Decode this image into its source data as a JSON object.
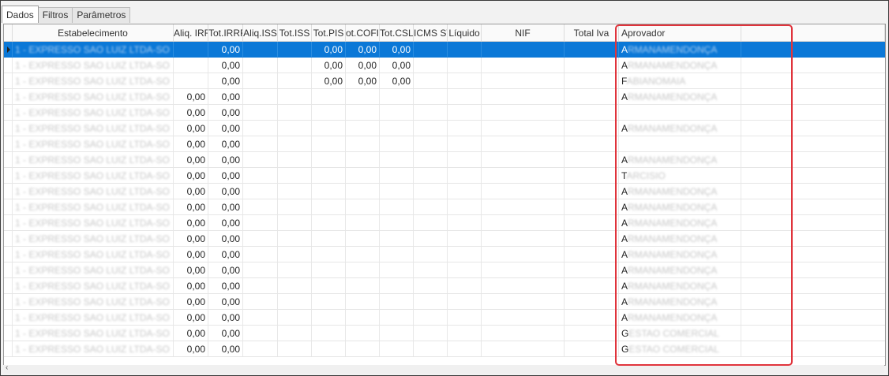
{
  "tabs": [
    {
      "label": "Dados",
      "active": true
    },
    {
      "label": "Filtros",
      "active": false
    },
    {
      "label": "Parâmetros",
      "active": false
    }
  ],
  "columns": [
    {
      "key": "ind",
      "label": "",
      "width": 11
    },
    {
      "key": "est",
      "label": "Estabelecimento",
      "width": 204
    },
    {
      "key": "aliq_irr",
      "label": "Aliq. IRR",
      "width": 44
    },
    {
      "key": "tot_irrf",
      "label": "Tot.IRRF",
      "width": 44
    },
    {
      "key": "aliq_iss",
      "label": "Aliq.ISS",
      "width": 44
    },
    {
      "key": "tot_iss",
      "label": "Tot.ISS",
      "width": 43
    },
    {
      "key": "tot_pis",
      "label": "Tot.PIS",
      "width": 43
    },
    {
      "key": "tot_cofins",
      "label": "ot.COFIN",
      "width": 43
    },
    {
      "key": "tot_csll",
      "label": "Tot.CSLL",
      "width": 43
    },
    {
      "key": "icms_st",
      "label": "ICMS ST",
      "width": 43
    },
    {
      "key": "liquido",
      "label": "Líquido",
      "width": 43
    },
    {
      "key": "nif",
      "label": "NIF",
      "width": 105
    },
    {
      "key": "total_iva",
      "label": "Total Iva",
      "width": 69
    },
    {
      "key": "aprovador",
      "label": "Aprovador",
      "width": 155
    },
    {
      "key": "extra",
      "label": "",
      "width": 182
    }
  ],
  "rows": [
    {
      "est": "1 - EXPRESSO SAO LUIZ LTDA-SO",
      "aliq_irr": "",
      "tot_irrf": "0,00",
      "tot_pis": "0,00",
      "tot_cofins": "0,00",
      "tot_csll": "0,00",
      "aprovador_initial": "A",
      "aprovador_rest": "RMANAMENDONÇA",
      "selected": true
    },
    {
      "est": "1 - EXPRESSO SAO LUIZ LTDA-SO",
      "aliq_irr": "",
      "tot_irrf": "0,00",
      "tot_pis": "0,00",
      "tot_cofins": "0,00",
      "tot_csll": "0,00",
      "aprovador_initial": "A",
      "aprovador_rest": "RMANAMENDONÇA"
    },
    {
      "est": "1 - EXPRESSO SAO LUIZ LTDA-SO",
      "aliq_irr": "",
      "tot_irrf": "0,00",
      "tot_pis": "0,00",
      "tot_cofins": "0,00",
      "tot_csll": "0,00",
      "aprovador_initial": "F",
      "aprovador_rest": "ABIANOMAIA"
    },
    {
      "est": "1 - EXPRESSO SAO LUIZ LTDA-SO",
      "aliq_irr": "0,00",
      "tot_irrf": "0,00",
      "aprovador_initial": "A",
      "aprovador_rest": "RMANAMENDONÇA"
    },
    {
      "est": "1 - EXPRESSO SAO LUIZ LTDA-SO",
      "aliq_irr": "0,00",
      "tot_irrf": "0,00",
      "aprovador_initial": "",
      "aprovador_rest": ""
    },
    {
      "est": "1 - EXPRESSO SAO LUIZ LTDA-SO",
      "aliq_irr": "0,00",
      "tot_irrf": "0,00",
      "aprovador_initial": "A",
      "aprovador_rest": "RMANAMENDONÇA"
    },
    {
      "est": "1 - EXPRESSO SAO LUIZ LTDA-SO",
      "aliq_irr": "0,00",
      "tot_irrf": "0,00",
      "aprovador_initial": "",
      "aprovador_rest": ""
    },
    {
      "est": "1 - EXPRESSO SAO LUIZ LTDA-SO",
      "aliq_irr": "0,00",
      "tot_irrf": "0,00",
      "aprovador_initial": "A",
      "aprovador_rest": "RMANAMENDONÇA"
    },
    {
      "est": "1 - EXPRESSO SAO LUIZ LTDA-SO",
      "aliq_irr": "0,00",
      "tot_irrf": "0,00",
      "aprovador_initial": "T",
      "aprovador_rest": "ARCISIO"
    },
    {
      "est": "1 - EXPRESSO SAO LUIZ LTDA-SO",
      "aliq_irr": "0,00",
      "tot_irrf": "0,00",
      "aprovador_initial": "A",
      "aprovador_rest": "RMANAMENDONÇA"
    },
    {
      "est": "1 - EXPRESSO SAO LUIZ LTDA-SO",
      "aliq_irr": "0,00",
      "tot_irrf": "0,00",
      "aprovador_initial": "A",
      "aprovador_rest": "RMANAMENDONÇA"
    },
    {
      "est": "1 - EXPRESSO SAO LUIZ LTDA-SO",
      "aliq_irr": "0,00",
      "tot_irrf": "0,00",
      "aprovador_initial": "A",
      "aprovador_rest": "RMANAMENDONÇA"
    },
    {
      "est": "1 - EXPRESSO SAO LUIZ LTDA-SO",
      "aliq_irr": "0,00",
      "tot_irrf": "0,00",
      "aprovador_initial": "A",
      "aprovador_rest": "RMANAMENDONÇA"
    },
    {
      "est": "1 - EXPRESSO SAO LUIZ LTDA-SO",
      "aliq_irr": "0,00",
      "tot_irrf": "0,00",
      "aprovador_initial": "A",
      "aprovador_rest": "RMANAMENDONÇA"
    },
    {
      "est": "1 - EXPRESSO SAO LUIZ LTDA-SO",
      "aliq_irr": "0,00",
      "tot_irrf": "0,00",
      "aprovador_initial": "A",
      "aprovador_rest": "RMANAMENDONÇA"
    },
    {
      "est": "1 - EXPRESSO SAO LUIZ LTDA-SO",
      "aliq_irr": "0,00",
      "tot_irrf": "0,00",
      "aprovador_initial": "A",
      "aprovador_rest": "RMANAMENDONÇA"
    },
    {
      "est": "1 - EXPRESSO SAO LUIZ LTDA-SO",
      "aliq_irr": "0,00",
      "tot_irrf": "0,00",
      "aprovador_initial": "A",
      "aprovador_rest": "RMANAMENDONÇA"
    },
    {
      "est": "1 - EXPRESSO SAO LUIZ LTDA-SO",
      "aliq_irr": "0,00",
      "tot_irrf": "0,00",
      "aprovador_initial": "A",
      "aprovador_rest": "RMANAMENDONÇA"
    },
    {
      "est": "1 - EXPRESSO SAO LUIZ LTDA-SO",
      "aliq_irr": "0,00",
      "tot_irrf": "0,00",
      "aprovador_initial": "G",
      "aprovador_rest": "ESTAO COMERCIAL"
    },
    {
      "est": "1 - EXPRESSO SAO LUIZ LTDA-SO",
      "aliq_irr": "0,00",
      "tot_irrf": "0,00",
      "aprovador_initial": "G",
      "aprovador_rest": "ESTAO COMERCIAL"
    }
  ],
  "scrollbar": {
    "left_arrow": "‹"
  },
  "colors": {
    "selection": "#0b78d7",
    "highlight_box": "#e0343c"
  }
}
